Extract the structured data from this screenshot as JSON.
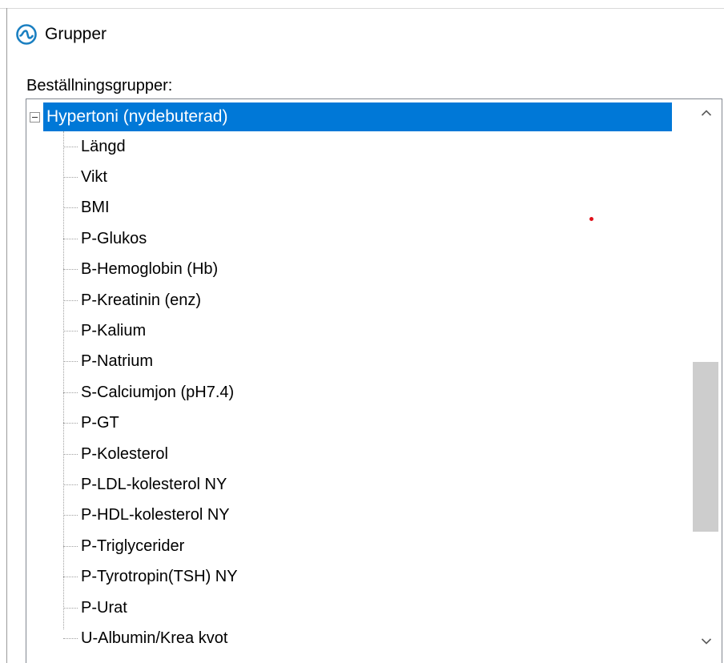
{
  "window": {
    "title": "Grupper",
    "icon": "circle-swirl-icon",
    "accent_color": "#0078d7"
  },
  "group_section": {
    "label": "Beställningsgrupper:"
  },
  "tree": {
    "root": {
      "label": "Hypertoni (nydebuterad)",
      "expanded": true,
      "selected": true
    },
    "children": [
      "Längd",
      "Vikt",
      "BMI",
      "P-Glukos",
      "B-Hemoglobin (Hb)",
      "P-Kreatinin (enz)",
      "P-Kalium",
      "P-Natrium",
      "S-Calciumjon (pH7.4)",
      "P-GT",
      "P-Kolesterol",
      "P-LDL-kolesterol NY",
      "P-HDL-kolesterol NY",
      "P-Triglycerider",
      "P-Tyrotropin(TSH) NY",
      "P-Urat",
      "U-Albumin/Krea kvot"
    ]
  },
  "scrollbar": {
    "up_icon": "chevron-up-icon",
    "down_icon": "chevron-down-icon"
  }
}
